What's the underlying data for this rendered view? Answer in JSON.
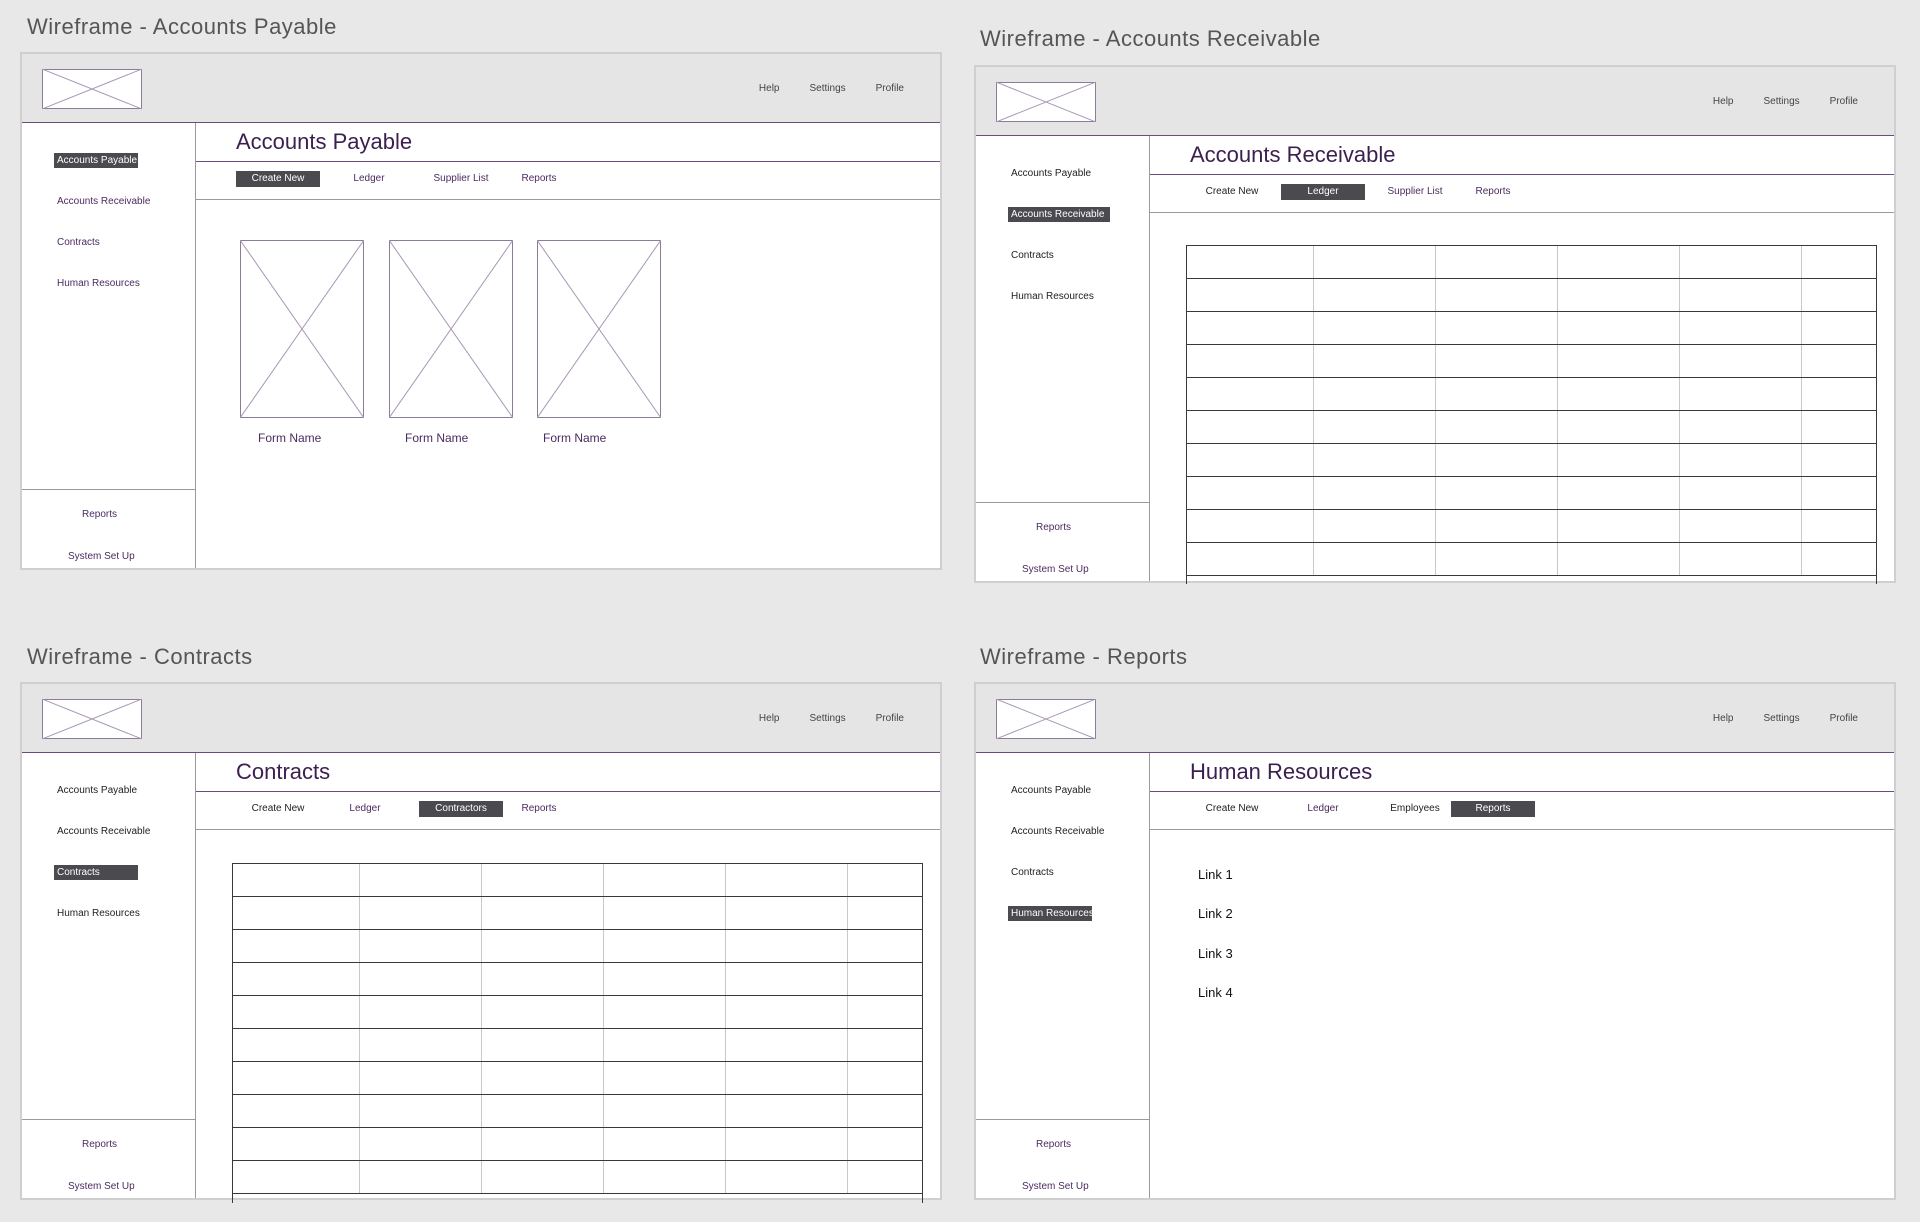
{
  "colors": {
    "accent": "#4b2b5f",
    "active_bg": "#4a4a4f",
    "canvas": "#e8e8e8"
  },
  "topnav": [
    "Help",
    "Settings",
    "Profile"
  ],
  "sidebar_items": [
    "Accounts Payable",
    "Accounts Receivable",
    "Contracts",
    "Human Resources"
  ],
  "sidebar_footer": [
    "Reports",
    "System Set Up"
  ],
  "panels": [
    {
      "caption": "Wireframe - Accounts Payable",
      "page_title": "Accounts Payable",
      "active_sidebar": 0,
      "tabs": [
        "Create New",
        "Ledger",
        "Supplier List",
        "Reports"
      ],
      "active_tab": 0,
      "forms": [
        "Form Name",
        "Form Name",
        "Form Name"
      ]
    },
    {
      "caption": "Wireframe - Accounts Receivable",
      "page_title": "Accounts Receivable",
      "active_sidebar": 1,
      "tabs": [
        "Create New",
        "Ledger",
        "Supplier List",
        "Reports"
      ],
      "active_tab": 1,
      "table": {
        "rows": 10,
        "cols": 6
      }
    },
    {
      "caption": "Wireframe - Contracts",
      "page_title": "Contracts",
      "active_sidebar": 2,
      "tabs": [
        "Create New",
        "Ledger",
        "Contractors",
        "Reports"
      ],
      "active_tab": 2,
      "table": {
        "rows": 10,
        "cols": 6
      }
    },
    {
      "caption": "Wireframe - Reports",
      "page_title": "Human Resources",
      "active_sidebar": 3,
      "tabs": [
        "Create New",
        "Ledger",
        "Employees",
        "Reports"
      ],
      "active_tab": 3,
      "links": [
        "Link 1",
        "Link 2",
        "Link 3",
        "Link 4"
      ]
    }
  ]
}
